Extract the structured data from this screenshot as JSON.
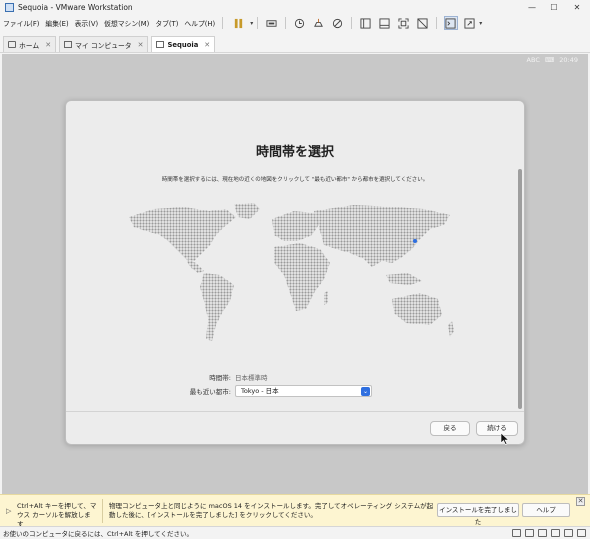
{
  "window": {
    "title": "Sequoia - VMware Workstation",
    "minimize": "—",
    "maximize": "☐",
    "close": "✕"
  },
  "menu": {
    "items": [
      "ファイル(F)",
      "編集(E)",
      "表示(V)",
      "仮想マシン(M)",
      "タブ(T)",
      "ヘルプ(H)"
    ]
  },
  "toolbar": {
    "icons": [
      "pause-icon",
      "send-keys-icon",
      "snapshot-icon",
      "revert-snapshot-icon",
      "manage-snapshots-icon",
      "view-library-icon",
      "thumbnail-icon",
      "fullscreen-icon",
      "unity-icon",
      "console-icon",
      "stretch-icon"
    ]
  },
  "tabs": [
    {
      "label": "ホーム",
      "active": false
    },
    {
      "label": "マイ コンピュータ",
      "active": false
    },
    {
      "label": "Sequoia",
      "active": true
    }
  ],
  "guest_status": {
    "input": "ABC",
    "time": "20:49"
  },
  "setup": {
    "title": "時間帯を選択",
    "description": "時間帯を選択するには、現在地の近くの地図をクリックして \"最も近い都市\" から都市を選択してください。",
    "timezone_label": "時間帯:",
    "timezone_value": "日本標準時",
    "city_label": "最も近い都市:",
    "city_value": "Tokyo - 日本",
    "back_button": "戻る",
    "continue_button": "続ける"
  },
  "notice": {
    "hint": "Ctrl+Alt キーを押して、マウス カーソルを解放します",
    "message": "物理コンピュータ上と同じように macOS 14 をインストールします。完了してオペレーティング システムが起動した後に、[インストールを完了しました] をクリックしてください。",
    "done_button": "インストールを完了しました",
    "help_button": "ヘルプ",
    "close": "✕"
  },
  "statusbar": {
    "text": "お使いのコンピュータに戻るには、Ctrl+Alt を押してください。"
  },
  "colors": {
    "accent": "#2f6fe0",
    "vm_background": "#c8c8c8",
    "map_land": "#9a9a9a",
    "notice_bg": "#fdf5d1"
  }
}
